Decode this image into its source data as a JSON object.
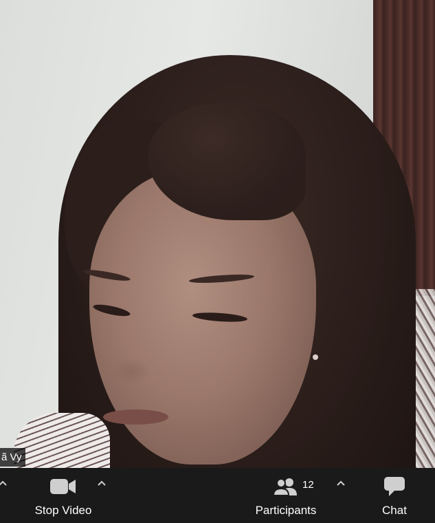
{
  "participant": {
    "name_label": "ã Vy"
  },
  "toolbar": {
    "stop_video_label": "Stop Video",
    "participants_label": "Participants",
    "participants_count": "12",
    "chat_label": "Chat"
  },
  "icons": {
    "video": "video-camera-icon",
    "participants": "people-icon",
    "chat": "speech-bubble-icon",
    "caret": "chevron-up-icon"
  },
  "colors": {
    "toolbar_bg": "#1a1a1a",
    "icon": "#cfcfcf",
    "text": "#ffffff"
  }
}
